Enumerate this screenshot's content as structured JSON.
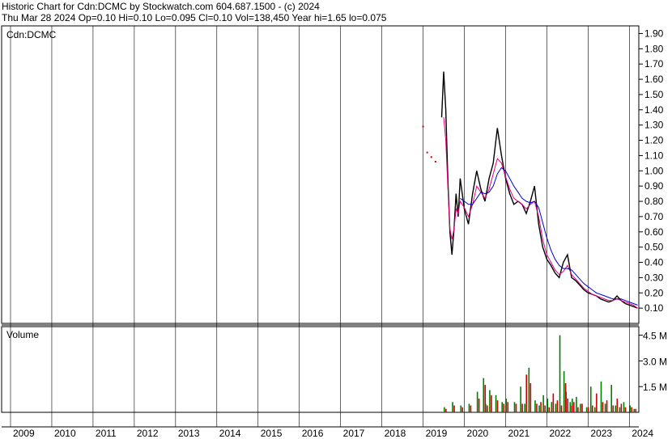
{
  "header": {
    "line1": "Historic Chart for Cdn:DCMC by Stockwatch.com 604.687.1500 - (c) 2024",
    "line2": "Thu Mar 28 2024   Op=0.10   Hi=0.10   Lo=0.095   Cl=0.10   Vol=138,450   Year hi=1.65   lo=0.075"
  },
  "chart_data": [
    {
      "type": "line",
      "panel": "price",
      "title": "Cdn:DCMC",
      "ylim": [
        0.0,
        1.95
      ],
      "yticks": [
        "0.10",
        "0.20",
        "0.30",
        "0.40",
        "0.50",
        "0.60",
        "0.70",
        "0.80",
        "0.90",
        "1.00",
        "1.10",
        "1.20",
        "1.30",
        "1.40",
        "1.50",
        "1.60",
        "1.70",
        "1.80",
        "1.90"
      ],
      "x": [
        "2019.0",
        "2019.1",
        "2019.2",
        "2019.3",
        "2019.45",
        "2019.5",
        "2019.55",
        "2019.6",
        "2019.65",
        "2019.7",
        "2019.75",
        "2019.8",
        "2019.85",
        "2019.9",
        "2020.0",
        "2020.1",
        "2020.2",
        "2020.3",
        "2020.4",
        "2020.5",
        "2020.6",
        "2020.7",
        "2020.8",
        "2020.9",
        "2021.0",
        "2021.1",
        "2021.2",
        "2021.3",
        "2021.4",
        "2021.5",
        "2021.6",
        "2021.7",
        "2021.8",
        "2021.9",
        "2022.0",
        "2022.1",
        "2022.2",
        "2022.3",
        "2022.4",
        "2022.5",
        "2022.6",
        "2022.7",
        "2022.8",
        "2022.9",
        "2023.0",
        "2023.1",
        "2023.2",
        "2023.3",
        "2023.4",
        "2023.5",
        "2023.6",
        "2023.7",
        "2023.8",
        "2023.9",
        "2024.0",
        "2024.1",
        "2024.2"
      ],
      "series": [
        {
          "name": "",
          "color": "#000000",
          "values": [
            1.29,
            1.12,
            1.09,
            1.06,
            1.35,
            1.65,
            1.4,
            0.95,
            0.6,
            0.45,
            0.62,
            0.85,
            0.7,
            0.95,
            0.75,
            0.65,
            0.85,
            1.0,
            0.88,
            0.8,
            0.95,
            1.05,
            1.28,
            1.1,
            0.95,
            0.85,
            0.78,
            0.8,
            0.78,
            0.72,
            0.8,
            0.9,
            0.65,
            0.5,
            0.42,
            0.38,
            0.33,
            0.3,
            0.4,
            0.45,
            0.3,
            0.28,
            0.25,
            0.22,
            0.2,
            0.19,
            0.18,
            0.16,
            0.15,
            0.14,
            0.15,
            0.18,
            0.15,
            0.13,
            0.12,
            0.11,
            0.1
          ]
        },
        {
          "name": "",
          "color": "#e0007f",
          "values": [
            null,
            null,
            null,
            null,
            null,
            1.35,
            1.2,
            0.9,
            0.62,
            0.55,
            0.62,
            0.75,
            0.72,
            0.8,
            0.76,
            0.7,
            0.78,
            0.9,
            0.86,
            0.82,
            0.88,
            0.98,
            1.08,
            1.05,
            0.96,
            0.88,
            0.82,
            0.8,
            0.78,
            0.75,
            0.78,
            0.8,
            0.7,
            0.55,
            0.45,
            0.4,
            0.35,
            0.32,
            0.34,
            0.38,
            0.32,
            0.29,
            0.26,
            0.23,
            0.21,
            0.19,
            0.18,
            0.17,
            0.16,
            0.15,
            0.15,
            0.16,
            0.15,
            0.14,
            0.13,
            0.12,
            0.1
          ]
        },
        {
          "name": "",
          "color": "#0000d0",
          "values": [
            null,
            null,
            null,
            null,
            null,
            null,
            null,
            null,
            null,
            null,
            null,
            null,
            null,
            0.82,
            0.8,
            0.78,
            0.78,
            0.82,
            0.86,
            0.85,
            0.86,
            0.9,
            0.98,
            1.02,
            1.0,
            0.95,
            0.9,
            0.86,
            0.82,
            0.8,
            0.79,
            0.8,
            0.76,
            0.66,
            0.56,
            0.48,
            0.42,
            0.38,
            0.36,
            0.36,
            0.35,
            0.32,
            0.29,
            0.26,
            0.24,
            0.22,
            0.2,
            0.19,
            0.18,
            0.17,
            0.16,
            0.16,
            0.16,
            0.15,
            0.14,
            0.13,
            0.12
          ]
        }
      ]
    },
    {
      "type": "bar",
      "panel": "volume",
      "title": "Volume",
      "ylim": [
        0,
        5.0
      ],
      "yticks": [
        "1.5 M",
        "3.0 M",
        "4.5 M"
      ],
      "x_ticks": [
        "2009",
        "2010",
        "2011",
        "2012",
        "2013",
        "2014",
        "2015",
        "2016",
        "2017",
        "2018",
        "2019",
        "2020",
        "2021",
        "2022",
        "2023",
        "2024"
      ],
      "x": [
        "2019.5",
        "2019.7",
        "2019.9",
        "2020.1",
        "2020.3",
        "2020.45",
        "2020.5",
        "2020.6",
        "2020.75",
        "2020.9",
        "2021.0",
        "2021.2",
        "2021.35",
        "2021.45",
        "2021.55",
        "2021.7",
        "2021.8",
        "2021.9",
        "2022.0",
        "2022.1",
        "2022.2",
        "2022.3",
        "2022.4",
        "2022.45",
        "2022.55",
        "2022.6",
        "2022.7",
        "2022.8",
        "2022.95",
        "2023.05",
        "2023.15",
        "2023.3",
        "2023.4",
        "2023.55",
        "2023.65",
        "2023.75",
        "2023.85",
        "2024.0",
        "2024.1"
      ],
      "series": [
        {
          "name": "",
          "color": "#008000",
          "values": [
            0.3,
            0.6,
            0.4,
            0.5,
            1.2,
            2.0,
            0.5,
            1.3,
            1.0,
            0.6,
            0.8,
            0.6,
            1.5,
            0.5,
            2.6,
            0.7,
            0.4,
            1.0,
            0.8,
            0.6,
            0.5,
            4.5,
            2.4,
            1.2,
            0.6,
            0.8,
            0.9,
            0.5,
            0.3,
            1.5,
            0.3,
            1.8,
            0.5,
            1.6,
            0.4,
            0.3,
            0.6,
            0.4,
            0.2
          ]
        },
        {
          "name": "",
          "color": "#d00000",
          "values": [
            0.2,
            0.4,
            0.3,
            0.4,
            0.8,
            1.6,
            0.4,
            1.0,
            0.7,
            0.5,
            0.6,
            0.5,
            0.5,
            2.2,
            1.7,
            0.5,
            0.6,
            0.4,
            0.3,
            1.1,
            0.7,
            0.4,
            1.7,
            0.8,
            0.4,
            0.6,
            0.3,
            0.5,
            0.3,
            0.4,
            1.1,
            0.6,
            0.7,
            0.4,
            0.8,
            0.5,
            0.3,
            0.3,
            0.2
          ]
        }
      ]
    }
  ]
}
